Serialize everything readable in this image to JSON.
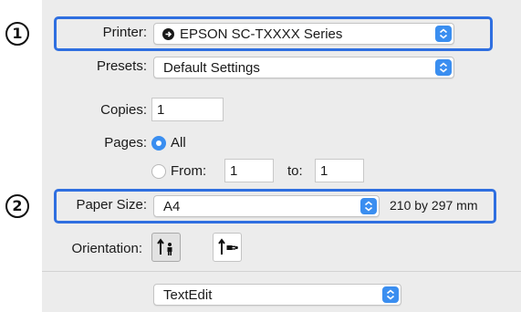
{
  "callouts": {
    "one": "1",
    "two": "2"
  },
  "printer": {
    "label": "Printer:",
    "value": "EPSON SC-TXXXX Series",
    "icon": "printer-status-icon"
  },
  "presets": {
    "label": "Presets:",
    "value": "Default Settings"
  },
  "copies": {
    "label": "Copies:",
    "value": "1"
  },
  "pages": {
    "label": "Pages:",
    "all_label": "All",
    "from_label": "From:",
    "from_value": "1",
    "to_label": "to:",
    "to_value": "1",
    "selected": "All"
  },
  "paper_size": {
    "label": "Paper Size:",
    "value": "A4",
    "dimensions": "210 by 297 mm"
  },
  "orientation": {
    "label": "Orientation:",
    "options": [
      "portrait",
      "landscape"
    ],
    "selected": "portrait"
  },
  "section_popup": {
    "value": "TextEdit"
  },
  "colors": {
    "accent": "#3a8ef0",
    "highlight": "#2f6fe0"
  }
}
